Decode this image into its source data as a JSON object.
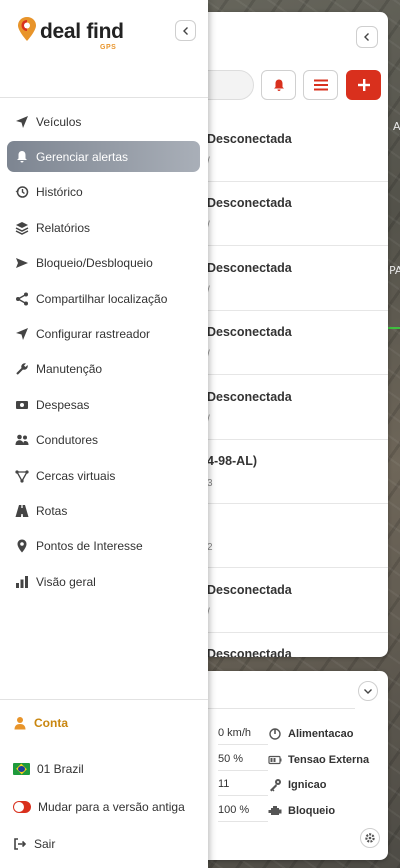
{
  "brand": {
    "name": "deal find",
    "tagline": "GPS"
  },
  "menu": [
    {
      "label": "Veículos",
      "icon": "navigation-arrow-icon"
    },
    {
      "label": "Gerenciar alertas",
      "icon": "bell-icon",
      "active": true
    },
    {
      "label": "Histórico",
      "icon": "history-icon"
    },
    {
      "label": "Relatórios",
      "icon": "layers-icon"
    },
    {
      "label": "Bloqueio/Desbloqueio",
      "icon": "send-icon"
    },
    {
      "label": "Compartilhar localização",
      "icon": "share-icon"
    },
    {
      "label": "Configurar rastreador",
      "icon": "navigation-arrow-icon"
    },
    {
      "label": "Manutenção",
      "icon": "wrench-icon"
    },
    {
      "label": "Despesas",
      "icon": "money-icon"
    },
    {
      "label": "Condutores",
      "icon": "users-icon"
    },
    {
      "label": "Cercas virtuais",
      "icon": "geofence-icon"
    },
    {
      "label": "Rotas",
      "icon": "road-icon"
    },
    {
      "label": "Pontos de Interesse",
      "icon": "map-pin-icon"
    },
    {
      "label": "Visão geral",
      "icon": "bar-chart-icon"
    }
  ],
  "footer": {
    "account": "Conta",
    "region": "01 Brazil",
    "legacy_switch": "Mudar para a versão antiga",
    "logout": "Sair"
  },
  "vehicle_list": {
    "rows": [
      {
        "status": "Desconectada",
        "sub": "/"
      },
      {
        "status": "Desconectada",
        "sub": "/"
      },
      {
        "status": "Desconectada",
        "sub": "/"
      },
      {
        "status": "Desconectada",
        "sub": "/"
      },
      {
        "status": "Desconectada",
        "sub": "/"
      },
      {
        "status": "4-98-AL)",
        "sub": "3"
      },
      {
        "status": "",
        "sub": "2"
      },
      {
        "status": "Desconectada",
        "sub": "/"
      },
      {
        "status": "Desconectada",
        "sub": ""
      }
    ]
  },
  "telemetry": {
    "rows": [
      {
        "value": "0 km/h",
        "label": "Alimentacao",
        "icon": "power-icon"
      },
      {
        "value": "50 %",
        "label": "Tensao Externa",
        "icon": "battery-icon"
      },
      {
        "value": "11",
        "label": "Ignicao",
        "icon": "key-icon"
      },
      {
        "value": "100 %",
        "label": "Bloqueio",
        "icon": "engine-icon"
      }
    ]
  },
  "map_labels": {
    "label_a": "A",
    "label_pa": "PA"
  },
  "colors": {
    "brand_red": "#d9301d",
    "brand_orange": "#e8942a",
    "active_item": "#7d8591"
  }
}
